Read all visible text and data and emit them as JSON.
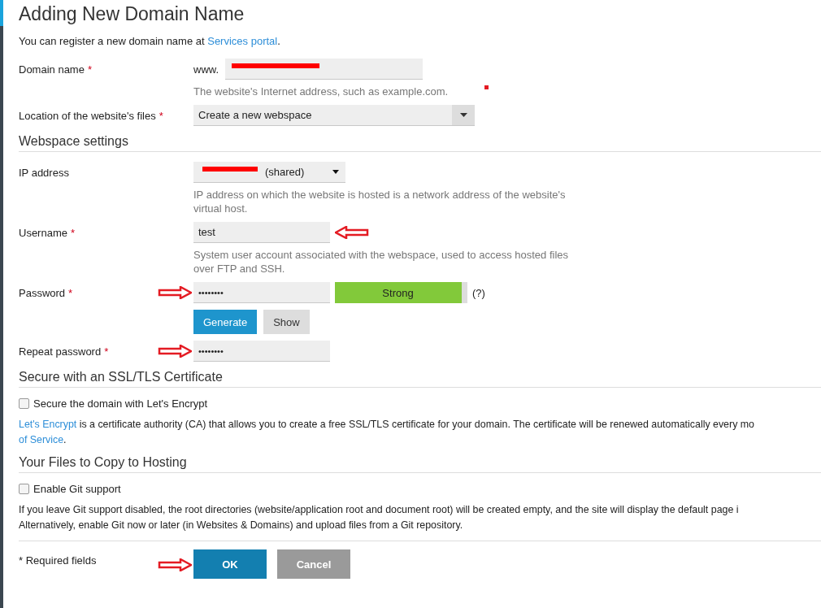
{
  "title": "Adding New Domain Name",
  "intro": {
    "text": "You can register a new domain name at",
    "link": "Services portal",
    "end": "."
  },
  "domain": {
    "label": "Domain name",
    "required_mark": "*",
    "prefix": "www.",
    "redacted": true,
    "hint": "The website's Internet address, such as example.com."
  },
  "location": {
    "label": "Location of the website's files",
    "required_mark": "*",
    "value": "Create a new webspace"
  },
  "webspace": {
    "heading": "Webspace settings",
    "ip": {
      "label": "IP address",
      "value": "(shared)",
      "redacted": true,
      "hint": "IP address on which the website is hosted is a network address of the website's virtual host."
    },
    "username": {
      "label": "Username",
      "required_mark": "*",
      "value": "test",
      "arrow": {
        "kind": "left"
      },
      "hint": "System user account associated with the webspace, used to access hosted files over FTP and SSH."
    },
    "password": {
      "label": "Password",
      "required_mark": "*",
      "value": "••••••••",
      "arrow": {
        "kind": "right"
      },
      "strength": "Strong",
      "level": 0.96,
      "help": "(?)",
      "buttons": [
        "Generate",
        "Show"
      ]
    },
    "repeat": {
      "label": "Repeat password",
      "required_mark": "*",
      "value": "••••••••",
      "arrow": {
        "kind": "right"
      }
    }
  },
  "ssl": {
    "heading": "Secure with an SSL/TLS Certificate",
    "checkbox": {
      "label": "Secure the domain with Let's Encrypt",
      "checked": false
    },
    "lines": [
      {
        "link": "Let's Encrypt",
        "text": " is a certificate authority (CA) that allows you to create a free SSL/TLS certificate for your domain. The certificate will be renewed automatically every mo"
      },
      {
        "link": "of Service",
        "text": "."
      }
    ]
  },
  "files": {
    "heading": "Your Files to Copy to Hosting",
    "checkbox": {
      "label": "Enable Git support",
      "checked": false
    },
    "lines": [
      "If you leave Git support disabled, the root directories (website/application root and document root) will be created empty, and the site will display the default page i",
      "Alternatively, enable Git now or later (in Websites & Domains) and upload files from a Git repository."
    ]
  },
  "footer": {
    "required_note": "* Required fields",
    "ok": {
      "label": "OK",
      "arrow": {
        "kind": "right"
      }
    },
    "cancel": "Cancel"
  }
}
